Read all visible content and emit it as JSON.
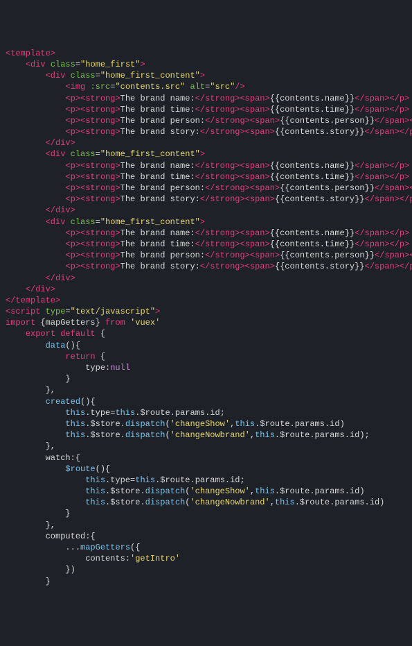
{
  "code": {
    "lines": [
      [
        [
          "tag",
          "<template>"
        ]
      ],
      [
        [
          "text",
          "    "
        ],
        [
          "tag",
          "<div "
        ],
        [
          "attr-name",
          "class"
        ],
        [
          "punct",
          "="
        ],
        [
          "attr-val",
          "\"home_first\""
        ],
        [
          "tag",
          ">"
        ]
      ],
      [
        [
          "text",
          "        "
        ],
        [
          "tag",
          "<div "
        ],
        [
          "attr-name",
          "class"
        ],
        [
          "punct",
          "="
        ],
        [
          "attr-val",
          "\"home_first_content\""
        ],
        [
          "tag",
          ">"
        ]
      ],
      [
        [
          "text",
          "            "
        ],
        [
          "tag",
          "<img "
        ],
        [
          "attr-name",
          ":src"
        ],
        [
          "punct",
          "="
        ],
        [
          "attr-val",
          "\"contents.src\""
        ],
        [
          "text",
          " "
        ],
        [
          "attr-name",
          "alt"
        ],
        [
          "punct",
          "="
        ],
        [
          "attr-val",
          "\"src\""
        ],
        [
          "tag",
          "/>"
        ]
      ],
      [
        [
          "text",
          "            "
        ],
        [
          "tag",
          "<p><strong>"
        ],
        [
          "text",
          "The brand name:"
        ],
        [
          "tag",
          "</strong><span>"
        ],
        [
          "text",
          "{{contents.name}}"
        ],
        [
          "tag",
          "</span></p>"
        ]
      ],
      [
        [
          "text",
          "            "
        ],
        [
          "tag",
          "<p><strong>"
        ],
        [
          "text",
          "The brand time:"
        ],
        [
          "tag",
          "</strong><span>"
        ],
        [
          "text",
          "{{contents.time}}"
        ],
        [
          "tag",
          "</span></p>"
        ]
      ],
      [
        [
          "text",
          "            "
        ],
        [
          "tag",
          "<p><strong>"
        ],
        [
          "text",
          "The brand person:"
        ],
        [
          "tag",
          "</strong><span>"
        ],
        [
          "text",
          "{{contents.person}}"
        ],
        [
          "tag",
          "</span></p>"
        ]
      ],
      [
        [
          "text",
          "            "
        ],
        [
          "tag",
          "<p><strong>"
        ],
        [
          "text",
          "The brand story:"
        ],
        [
          "tag",
          "</strong><span>"
        ],
        [
          "text",
          "{{contents.story}}"
        ],
        [
          "tag",
          "</span></p>"
        ]
      ],
      [
        [
          "text",
          "        "
        ],
        [
          "tag",
          "</div>"
        ]
      ],
      [
        [
          "text",
          "        "
        ],
        [
          "tag",
          "<div "
        ],
        [
          "attr-name",
          "class"
        ],
        [
          "punct",
          "="
        ],
        [
          "attr-val",
          "\"home_first_content\""
        ],
        [
          "tag",
          ">"
        ]
      ],
      [
        [
          "text",
          "            "
        ],
        [
          "tag",
          "<p><strong>"
        ],
        [
          "text",
          "The brand name:"
        ],
        [
          "tag",
          "</strong><span>"
        ],
        [
          "text",
          "{{contents.name}}"
        ],
        [
          "tag",
          "</span></p>"
        ]
      ],
      [
        [
          "text",
          "            "
        ],
        [
          "tag",
          "<p><strong>"
        ],
        [
          "text",
          "The brand time:"
        ],
        [
          "tag",
          "</strong><span>"
        ],
        [
          "text",
          "{{contents.time}}"
        ],
        [
          "tag",
          "</span></p>"
        ]
      ],
      [
        [
          "text",
          "            "
        ],
        [
          "tag",
          "<p><strong>"
        ],
        [
          "text",
          "The brand person:"
        ],
        [
          "tag",
          "</strong><span>"
        ],
        [
          "text",
          "{{contents.person}}"
        ],
        [
          "tag",
          "</span></p>"
        ]
      ],
      [
        [
          "text",
          "            "
        ],
        [
          "tag",
          "<p><strong>"
        ],
        [
          "text",
          "The brand story:"
        ],
        [
          "tag",
          "</strong><span>"
        ],
        [
          "text",
          "{{contents.story}}"
        ],
        [
          "tag",
          "</span></p>"
        ]
      ],
      [
        [
          "text",
          "        "
        ],
        [
          "tag",
          "</div>"
        ]
      ],
      [
        [
          "text",
          "        "
        ],
        [
          "tag",
          "<div "
        ],
        [
          "attr-name",
          "class"
        ],
        [
          "punct",
          "="
        ],
        [
          "attr-val",
          "\"home_first_content\""
        ],
        [
          "tag",
          ">"
        ]
      ],
      [
        [
          "text",
          "            "
        ],
        [
          "tag",
          "<p><strong>"
        ],
        [
          "text",
          "The brand name:"
        ],
        [
          "tag",
          "</strong><span>"
        ],
        [
          "text",
          "{{contents.name}}"
        ],
        [
          "tag",
          "</span></p>"
        ]
      ],
      [
        [
          "text",
          "            "
        ],
        [
          "tag",
          "<p><strong>"
        ],
        [
          "text",
          "The brand time:"
        ],
        [
          "tag",
          "</strong><span>"
        ],
        [
          "text",
          "{{contents.time}}"
        ],
        [
          "tag",
          "</span></p>"
        ]
      ],
      [
        [
          "text",
          "            "
        ],
        [
          "tag",
          "<p><strong>"
        ],
        [
          "text",
          "The brand person:"
        ],
        [
          "tag",
          "</strong><span>"
        ],
        [
          "text",
          "{{contents.person}}"
        ],
        [
          "tag",
          "</span></p>"
        ]
      ],
      [
        [
          "text",
          "            "
        ],
        [
          "tag",
          "<p><strong>"
        ],
        [
          "text",
          "The brand story:"
        ],
        [
          "tag",
          "</strong><span>"
        ],
        [
          "text",
          "{{contents.story}}"
        ],
        [
          "tag",
          "</span></p>"
        ]
      ],
      [
        [
          "text",
          "        "
        ],
        [
          "tag",
          "</div>"
        ]
      ],
      [
        [
          "text",
          "    "
        ],
        [
          "tag",
          "</div>"
        ]
      ],
      [
        [
          "tag",
          "</template>"
        ]
      ],
      [
        [
          "tag",
          "<script "
        ],
        [
          "attr-name",
          "type"
        ],
        [
          "punct",
          "="
        ],
        [
          "attr-val",
          "\"text/javascript\""
        ],
        [
          "tag",
          ">"
        ]
      ],
      [
        [
          "kw",
          "import "
        ],
        [
          "punct",
          "{"
        ],
        [
          "ident",
          "mapGetters"
        ],
        [
          "punct",
          "}"
        ],
        [
          "kw",
          " from "
        ],
        [
          "str",
          "'vuex'"
        ]
      ],
      [
        [
          "text",
          "    "
        ],
        [
          "kw",
          "export default "
        ],
        [
          "punct",
          "{"
        ]
      ],
      [
        [
          "text",
          "        "
        ],
        [
          "prop",
          "data"
        ],
        [
          "punct",
          "(){"
        ]
      ],
      [
        [
          "text",
          "            "
        ],
        [
          "kw",
          "return "
        ],
        [
          "punct",
          "{"
        ]
      ],
      [
        [
          "text",
          "                "
        ],
        [
          "ident",
          "type"
        ],
        [
          "punct",
          ":"
        ],
        [
          "num",
          "null"
        ]
      ],
      [
        [
          "text",
          "            "
        ],
        [
          "punct",
          "}"
        ]
      ],
      [
        [
          "text",
          "        "
        ],
        [
          "punct",
          "},"
        ]
      ],
      [
        [
          "text",
          "        "
        ],
        [
          "prop",
          "created"
        ],
        [
          "punct",
          "(){"
        ]
      ],
      [
        [
          "text",
          "            "
        ],
        [
          "kw2",
          "this"
        ],
        [
          "punct",
          "."
        ],
        [
          "ident",
          "type"
        ],
        [
          "punct",
          "="
        ],
        [
          "kw2",
          "this"
        ],
        [
          "punct",
          "."
        ],
        [
          "ident",
          "$route"
        ],
        [
          "punct",
          "."
        ],
        [
          "ident",
          "params"
        ],
        [
          "punct",
          "."
        ],
        [
          "ident",
          "id"
        ],
        [
          "punct",
          ";"
        ]
      ],
      [
        [
          "text",
          "            "
        ],
        [
          "kw2",
          "this"
        ],
        [
          "punct",
          "."
        ],
        [
          "ident",
          "$store"
        ],
        [
          "punct",
          "."
        ],
        [
          "prop",
          "dispatch"
        ],
        [
          "punct",
          "("
        ],
        [
          "str",
          "'changeShow'"
        ],
        [
          "punct",
          ","
        ],
        [
          "kw2",
          "this"
        ],
        [
          "punct",
          "."
        ],
        [
          "ident",
          "$route"
        ],
        [
          "punct",
          "."
        ],
        [
          "ident",
          "params"
        ],
        [
          "punct",
          "."
        ],
        [
          "ident",
          "id"
        ],
        [
          "punct",
          ")"
        ]
      ],
      [
        [
          "text",
          "            "
        ],
        [
          "kw2",
          "this"
        ],
        [
          "punct",
          "."
        ],
        [
          "ident",
          "$store"
        ],
        [
          "punct",
          "."
        ],
        [
          "prop",
          "dispatch"
        ],
        [
          "punct",
          "("
        ],
        [
          "str",
          "'changeNowbrand'"
        ],
        [
          "punct",
          ","
        ],
        [
          "kw2",
          "this"
        ],
        [
          "punct",
          "."
        ],
        [
          "ident",
          "$route"
        ],
        [
          "punct",
          "."
        ],
        [
          "ident",
          "params"
        ],
        [
          "punct",
          "."
        ],
        [
          "ident",
          "id"
        ],
        [
          "punct",
          ");"
        ]
      ],
      [
        [
          "text",
          "        "
        ],
        [
          "punct",
          "},"
        ]
      ],
      [
        [
          "text",
          "        "
        ],
        [
          "ident",
          "watch"
        ],
        [
          "punct",
          ":{"
        ]
      ],
      [
        [
          "text",
          "            "
        ],
        [
          "prop",
          "$route"
        ],
        [
          "punct",
          "(){"
        ]
      ],
      [
        [
          "text",
          "                "
        ],
        [
          "kw2",
          "this"
        ],
        [
          "punct",
          "."
        ],
        [
          "ident",
          "type"
        ],
        [
          "punct",
          "="
        ],
        [
          "kw2",
          "this"
        ],
        [
          "punct",
          "."
        ],
        [
          "ident",
          "$route"
        ],
        [
          "punct",
          "."
        ],
        [
          "ident",
          "params"
        ],
        [
          "punct",
          "."
        ],
        [
          "ident",
          "id"
        ],
        [
          "punct",
          ";"
        ]
      ],
      [
        [
          "text",
          "                "
        ],
        [
          "kw2",
          "this"
        ],
        [
          "punct",
          "."
        ],
        [
          "ident",
          "$store"
        ],
        [
          "punct",
          "."
        ],
        [
          "prop",
          "dispatch"
        ],
        [
          "punct",
          "("
        ],
        [
          "str",
          "'changeShow'"
        ],
        [
          "punct",
          ","
        ],
        [
          "kw2",
          "this"
        ],
        [
          "punct",
          "."
        ],
        [
          "ident",
          "$route"
        ],
        [
          "punct",
          "."
        ],
        [
          "ident",
          "params"
        ],
        [
          "punct",
          "."
        ],
        [
          "ident",
          "id"
        ],
        [
          "punct",
          ")"
        ]
      ],
      [
        [
          "text",
          "                "
        ],
        [
          "kw2",
          "this"
        ],
        [
          "punct",
          "."
        ],
        [
          "ident",
          "$store"
        ],
        [
          "punct",
          "."
        ],
        [
          "prop",
          "dispatch"
        ],
        [
          "punct",
          "("
        ],
        [
          "str",
          "'changeNowbrand'"
        ],
        [
          "punct",
          ","
        ],
        [
          "kw2",
          "this"
        ],
        [
          "punct",
          "."
        ],
        [
          "ident",
          "$route"
        ],
        [
          "punct",
          "."
        ],
        [
          "ident",
          "params"
        ],
        [
          "punct",
          "."
        ],
        [
          "ident",
          "id"
        ],
        [
          "punct",
          ")"
        ]
      ],
      [
        [
          "text",
          "            "
        ],
        [
          "punct",
          "}"
        ]
      ],
      [
        [
          "text",
          "        "
        ],
        [
          "punct",
          "},"
        ]
      ],
      [
        [
          "text",
          "        "
        ],
        [
          "ident",
          "computed"
        ],
        [
          "punct",
          ":{"
        ]
      ],
      [
        [
          "text",
          "            "
        ],
        [
          "punct",
          "..."
        ],
        [
          "prop",
          "mapGetters"
        ],
        [
          "punct",
          "({"
        ]
      ],
      [
        [
          "text",
          "                "
        ],
        [
          "ident",
          "contents"
        ],
        [
          "punct",
          ":"
        ],
        [
          "str",
          "'getIntro'"
        ]
      ],
      [
        [
          "text",
          "            "
        ],
        [
          "punct",
          "})"
        ]
      ],
      [
        [
          "text",
          ""
        ]
      ],
      [
        [
          "text",
          "        "
        ],
        [
          "punct",
          "}"
        ]
      ]
    ]
  }
}
